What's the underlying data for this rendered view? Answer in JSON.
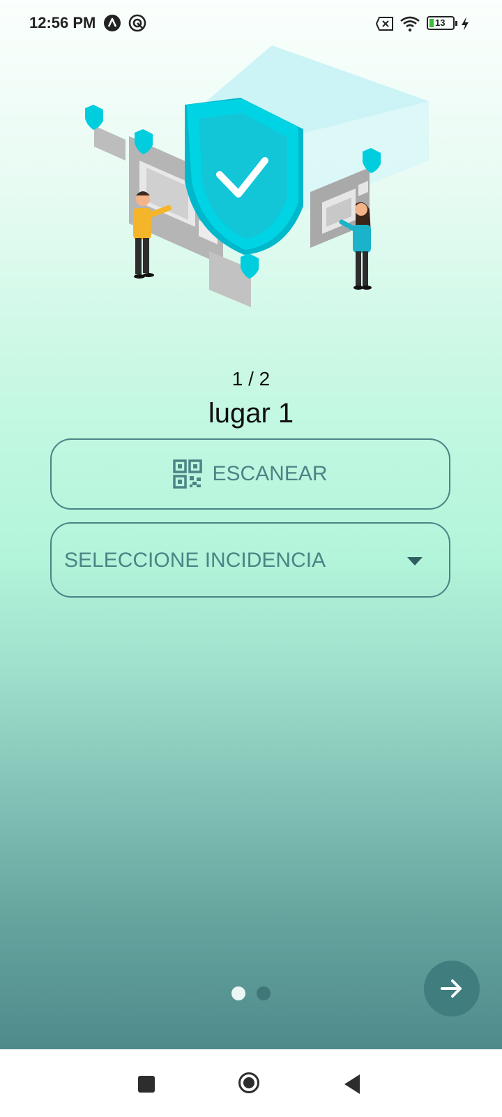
{
  "status_bar": {
    "time": "12:56 PM",
    "battery": "13",
    "icons": [
      "app-a-icon",
      "sync-icon",
      "no-sim-icon",
      "wifi-icon",
      "battery-icon",
      "charging-icon"
    ]
  },
  "pager": {
    "current": 1,
    "total": 2,
    "count_label": "1 / 2"
  },
  "place": {
    "title": "lugar 1"
  },
  "scan_button": {
    "label": "ESCANEAR",
    "icon": "qr-code-icon"
  },
  "incidence_select": {
    "value": "SELECCIONE INCIDENCIA",
    "icon": "dropdown-caret-icon"
  },
  "page_indicator": {
    "pages": 2,
    "active_index": 0
  },
  "next_button": {
    "icon": "arrow-right-icon"
  },
  "nav_bar": {
    "icons": [
      "recents-square-icon",
      "home-circle-icon",
      "back-triangle-icon"
    ]
  },
  "colors": {
    "accent": "#4c8385",
    "fab": "#3f7d7f",
    "shield": "#00d4e4"
  }
}
